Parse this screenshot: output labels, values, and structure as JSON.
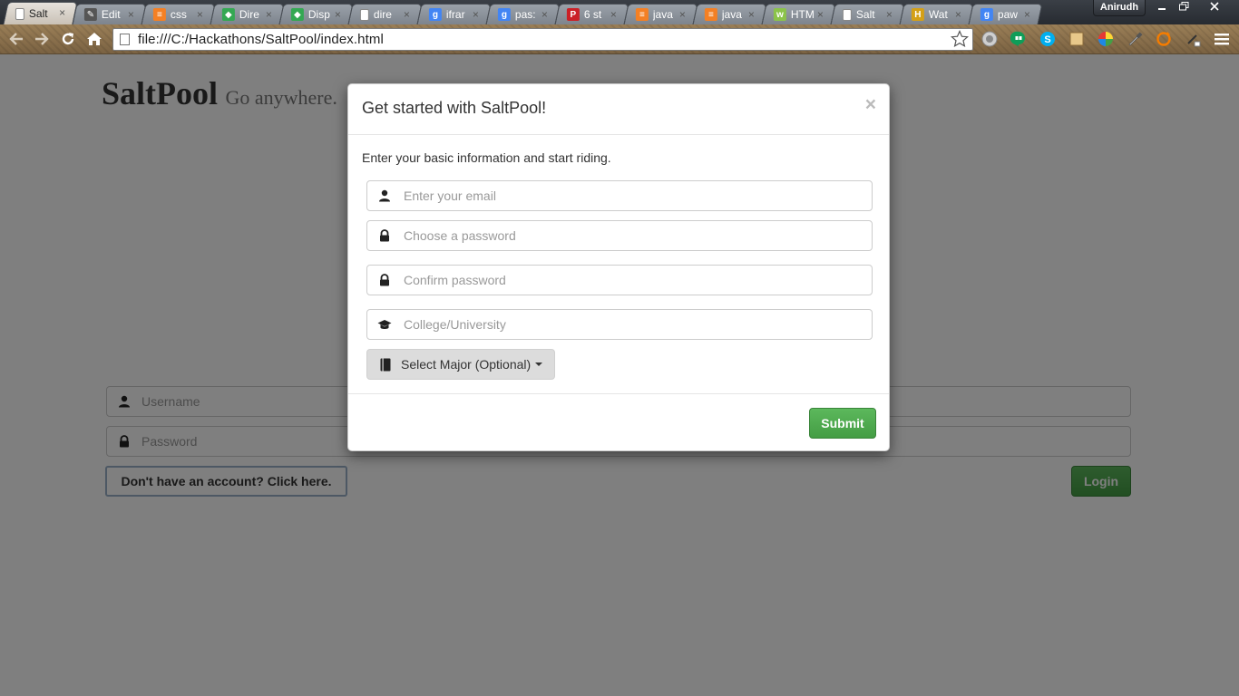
{
  "browser": {
    "tabs": [
      {
        "title": "Salt",
        "favicon": "page-icon",
        "favicon_color": "#ffffff",
        "active": true
      },
      {
        "title": "Edit",
        "favicon": "editor-icon",
        "favicon_color": "#555555",
        "active": false
      },
      {
        "title": "css",
        "favicon": "stackoverflow-icon",
        "favicon_color": "#f48024",
        "active": false
      },
      {
        "title": "Dire",
        "favicon": "google-maps-icon",
        "favicon_color": "#34a853",
        "active": false
      },
      {
        "title": "Disp",
        "favicon": "google-maps-icon",
        "favicon_color": "#34a853",
        "active": false
      },
      {
        "title": "dire",
        "favicon": "page-icon",
        "favicon_color": "#ffffff",
        "active": false
      },
      {
        "title": "ifrar",
        "favicon": "google-icon",
        "favicon_color": "#4285f4",
        "active": false
      },
      {
        "title": "pas:",
        "favicon": "google-icon",
        "favicon_color": "#4285f4",
        "active": false
      },
      {
        "title": "6 st",
        "favicon": "pinterest-icon",
        "favicon_color": "#cb2027",
        "active": false
      },
      {
        "title": "java",
        "favicon": "stackoverflow-icon",
        "favicon_color": "#f48024",
        "active": false
      },
      {
        "title": "java",
        "favicon": "stackoverflow-icon",
        "favicon_color": "#f48024",
        "active": false
      },
      {
        "title": "HTM",
        "favicon": "w3c-icon",
        "favicon_color": "#8bc34a",
        "active": false
      },
      {
        "title": "Salt",
        "favicon": "page-icon",
        "favicon_color": "#ffffff",
        "active": false
      },
      {
        "title": "Wat",
        "favicon": "history-icon",
        "favicon_color": "#d4a017",
        "active": false
      },
      {
        "title": "paw",
        "favicon": "google-icon",
        "favicon_color": "#4285f4",
        "active": false
      }
    ],
    "profile_name": "Anirudh",
    "url": "file:///C:/Hackathons/SaltPool/index.html"
  },
  "page": {
    "brand": "SaltPool",
    "tagline": "Go anywhere.",
    "login": {
      "username_placeholder": "Username",
      "password_placeholder": "Password",
      "signup_label": "Don't have an account? Click here.",
      "login_label": "Login"
    }
  },
  "modal": {
    "title": "Get started with SaltPool!",
    "close_label": "×",
    "intro": "Enter your basic information and start riding.",
    "email_placeholder": "Enter your email",
    "password_placeholder": "Choose a password",
    "confirm_placeholder": "Confirm password",
    "college_placeholder": "College/University",
    "major_label": "Select Major (Optional)",
    "submit_label": "Submit"
  },
  "colors": {
    "success": "#5cb85c",
    "backdrop": "#000000"
  }
}
